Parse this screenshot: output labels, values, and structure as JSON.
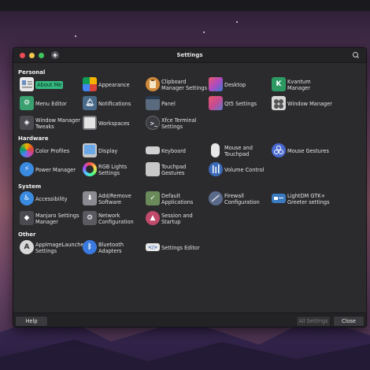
{
  "window": {
    "title": "Settings"
  },
  "footer": {
    "help": "Help",
    "all_settings": "All Settings",
    "close": "Close"
  },
  "categories": [
    {
      "title": "Personal"
    },
    {
      "title": "Hardware"
    },
    {
      "title": "System"
    },
    {
      "title": "Other"
    }
  ],
  "items": {
    "about_me": "About Me",
    "appearance": "Appearance",
    "clipboard_manager_settings": "Clipboard Manager Settings",
    "desktop": "Desktop",
    "kvantum_manager": "Kvantum Manager",
    "menu_editor": "Menu Editor",
    "notifications": "Notifications",
    "panel": "Panel",
    "qt5_settings": "Qt5 Settings",
    "window_manager": "Window Manager",
    "window_manager_tweaks": "Window Manager Tweaks",
    "workspaces": "Workspaces",
    "xfce_terminal_settings": "Xfce Terminal Settings",
    "color_profiles": "Color Profiles",
    "display": "Display",
    "keyboard": "Keyboard",
    "mouse_touchpad": "Mouse and Touchpad",
    "mouse_gestures": "Mouse Gestures",
    "power_manager": "Power Manager",
    "rgb_lights": "RGB Lights Settings",
    "touchpad_gestures": "Touchpad Gestures",
    "volume_control": "Volume Control",
    "accessibility": "Accessibility",
    "add_remove_software": "Add/Remove Software",
    "default_applications": "Default Applications",
    "firewall": "Firewall Configuration",
    "lightdm_greeter": "LightDM GTK+ Greeter settings",
    "manjaro_settings": "Manjaro Settings Manager",
    "network_configuration": "Network Configuration",
    "session_startup": "Session and Startup",
    "appimage_launcher": "AppImageLauncher Settings",
    "bluetooth_adapters": "Bluetooth Adapters",
    "settings_editor": "Settings Editor"
  },
  "colors": {
    "selection": "#34b880",
    "window_bg": "#2b2b2e"
  }
}
